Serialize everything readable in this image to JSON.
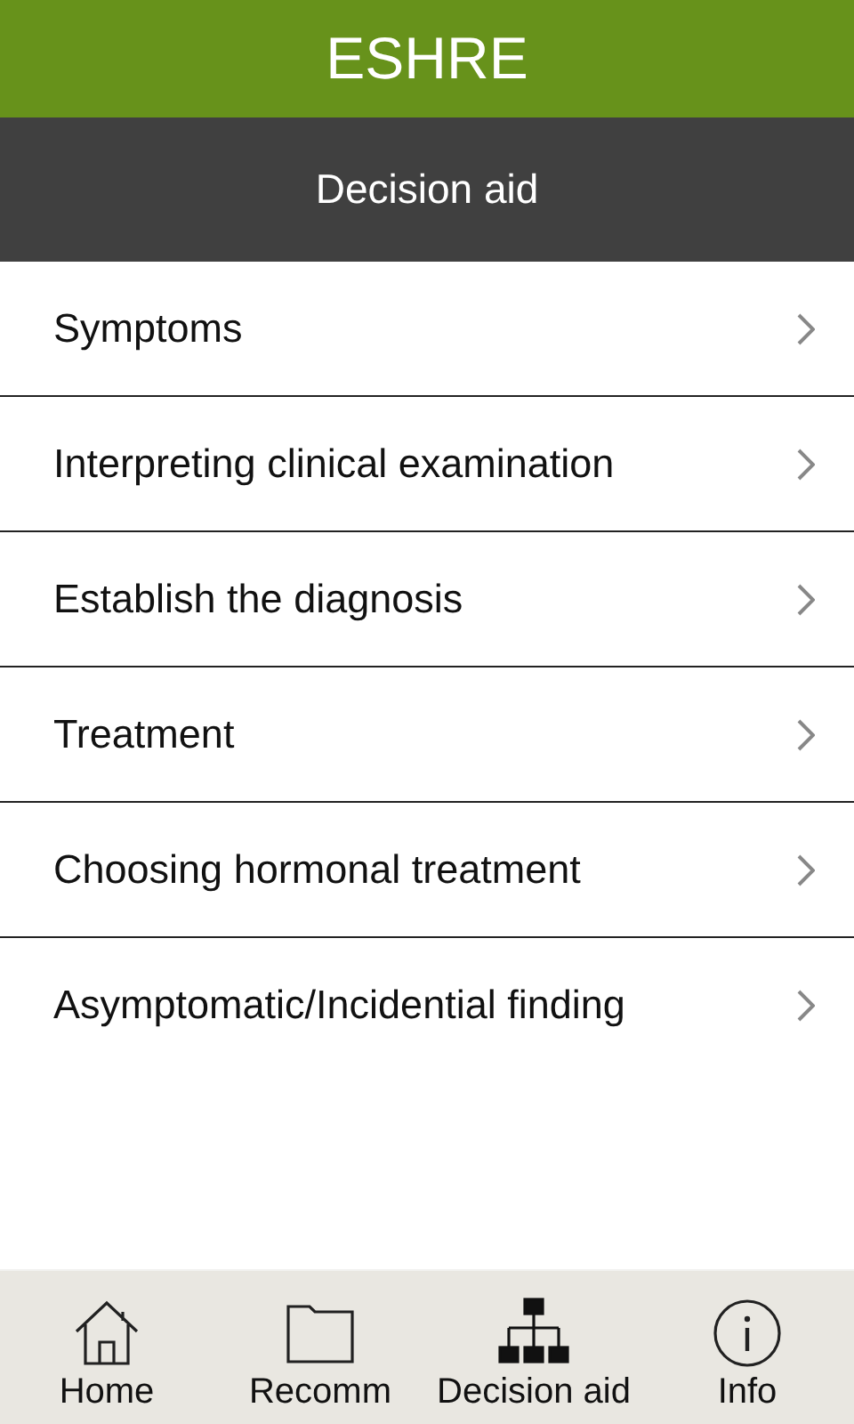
{
  "app_bar": {
    "title": "ESHRE"
  },
  "section_header": {
    "title": "Decision aid"
  },
  "menu_items": [
    {
      "label": "Symptoms"
    },
    {
      "label": "Interpreting clinical examination"
    },
    {
      "label": "Establish the diagnosis"
    },
    {
      "label": "Treatment"
    },
    {
      "label": "Choosing hormonal treatment"
    },
    {
      "label": "Asymptomatic/Incidential finding"
    }
  ],
  "bottom_nav": [
    {
      "label": "Home",
      "kind": "home",
      "selected": false
    },
    {
      "label": "Recomm",
      "kind": "folder",
      "selected": false
    },
    {
      "label": "Decision aid",
      "kind": "hierarchy",
      "selected": true
    },
    {
      "label": "Info",
      "kind": "info",
      "selected": false
    }
  ]
}
